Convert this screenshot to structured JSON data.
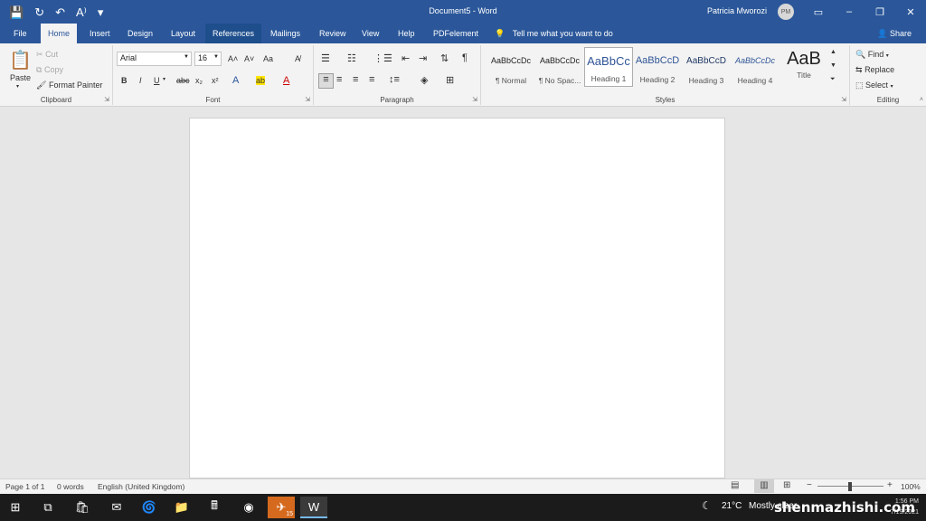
{
  "window": {
    "title": "Document5  -  Word",
    "user_name": "Patricia Mworozi",
    "user_initials": "PM"
  },
  "qat": {
    "save_icon": "💾",
    "undo_icon": "↶",
    "redo_icon": "↻",
    "read_aloud_icon": "A⁾",
    "customize_icon": "▾"
  },
  "menu_tabs": {
    "file": "File",
    "home": "Home",
    "insert": "Insert",
    "design": "Design",
    "layout": "Layout",
    "references": "References",
    "mailings": "Mailings",
    "review": "Review",
    "view": "View",
    "help": "Help",
    "pdfelement": "PDFelement",
    "tell_me": "Tell me what you want to do",
    "share": "Share"
  },
  "clipboard": {
    "paste": "Paste",
    "cut": "Cut",
    "copy": "Copy",
    "format_painter": "Format Painter",
    "label": "Clipboard"
  },
  "font": {
    "family": "Arial",
    "size": "16",
    "label": "Font",
    "bold": "B",
    "italic": "I",
    "underline": "U",
    "strikethrough": "abc",
    "subscript": "x₂",
    "superscript": "x²",
    "grow": "A˄",
    "shrink": "A˅",
    "change_case": "Aa",
    "text_effects": "A",
    "highlight": "ab",
    "font_color": "A",
    "clear": "A̸"
  },
  "paragraph": {
    "label": "Paragraph",
    "show_marks": "¶"
  },
  "styles": {
    "label": "Styles",
    "items": [
      {
        "preview": "AaBbCcDc",
        "name": "¶ Normal"
      },
      {
        "preview": "AaBbCcDc",
        "name": "¶ No Spac..."
      },
      {
        "preview": "AaBbCc",
        "name": "Heading 1"
      },
      {
        "preview": "AaBbCcD",
        "name": "Heading 2"
      },
      {
        "preview": "AaBbCcD",
        "name": "Heading 3"
      },
      {
        "preview": "AaBbCcDc",
        "name": "Heading 4"
      },
      {
        "preview": "AaB",
        "name": "Title"
      }
    ]
  },
  "editing": {
    "label": "Editing",
    "find": "Find",
    "replace": "Replace",
    "select": "Select"
  },
  "status": {
    "page": "Page 1 of 1",
    "words": "0 words",
    "language": "English (United Kingdom)",
    "zoom": "100%"
  },
  "taskbar": {
    "mail_badge": "15",
    "weather": "21°C",
    "weather_desc": "Mostly clear",
    "time": "1:56 PM",
    "date": "7/19/2021",
    "watermark": "shenmazhishi.com"
  }
}
